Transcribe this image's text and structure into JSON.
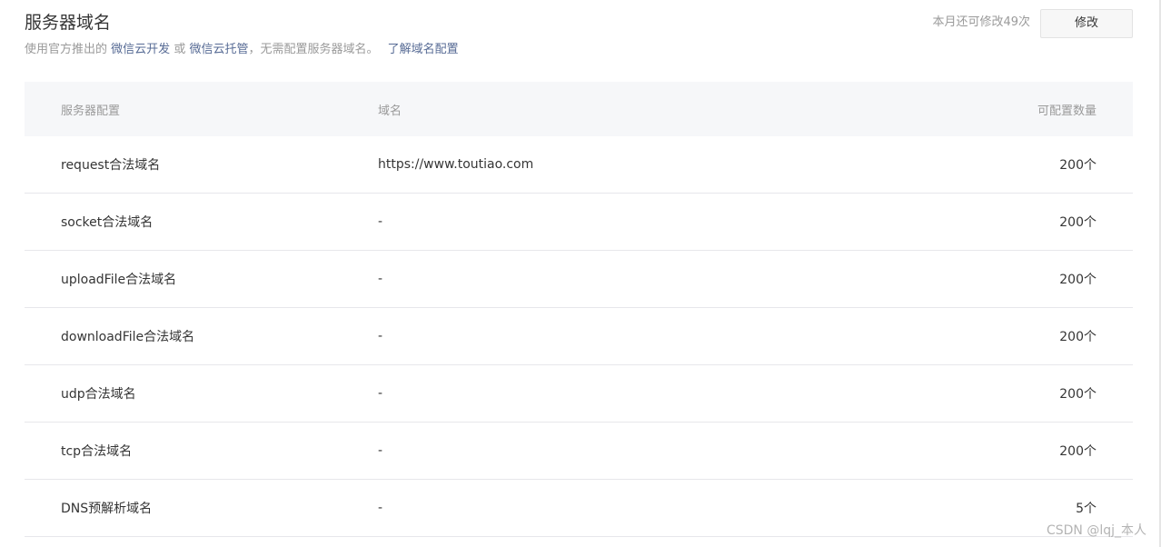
{
  "header": {
    "title": "服务器域名",
    "desc_prefix": "使用官方推出的",
    "link_cloud_dev": "微信云开发",
    "desc_or": "或",
    "link_cloud_host": "微信云托管",
    "desc_suffix": "，无需配置服务器域名。",
    "link_learn": "了解域名配置",
    "quota_text": "本月还可修改49次",
    "edit_label": "修改"
  },
  "table": {
    "columns": [
      "服务器配置",
      "域名",
      "可配置数量"
    ],
    "rows": [
      {
        "config": "request合法域名",
        "domain": "https://www.toutiao.com",
        "count": "200个"
      },
      {
        "config": "socket合法域名",
        "domain": "-",
        "count": "200个"
      },
      {
        "config": "uploadFile合法域名",
        "domain": "-",
        "count": "200个"
      },
      {
        "config": "downloadFile合法域名",
        "domain": "-",
        "count": "200个"
      },
      {
        "config": "udp合法域名",
        "domain": "-",
        "count": "200个"
      },
      {
        "config": "tcp合法域名",
        "domain": "-",
        "count": "200个"
      },
      {
        "config": "DNS预解析域名",
        "domain": "-",
        "count": "5个"
      }
    ]
  },
  "watermark": "CSDN @lqj_本人",
  "colors": {
    "link": "#576b95",
    "muted_text": "#9a9a9a",
    "header_bg": "#f6f7f9",
    "row_border": "#e7e7eb"
  }
}
